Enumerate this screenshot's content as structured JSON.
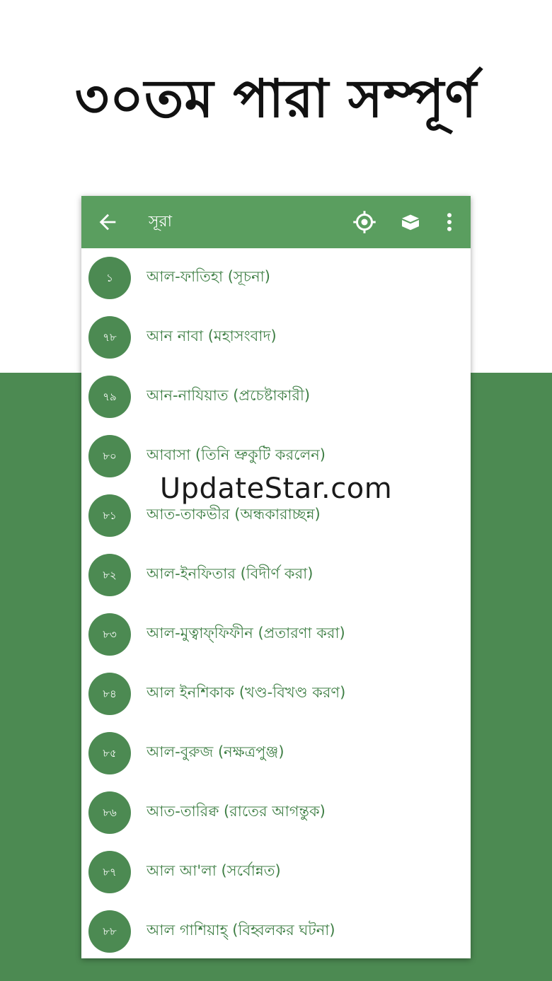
{
  "headline": "৩০তম পারা সম্পূর্ণ",
  "toolbar": {
    "title": "সূরা",
    "back_icon": "arrow-left-icon",
    "actions": [
      "target-icon",
      "kaaba-icon",
      "more-vert-icon"
    ]
  },
  "surahs": [
    {
      "number": "১",
      "name": "আল-ফাতিহা (সূচনা)"
    },
    {
      "number": "৭৮",
      "name": "আন নাবা (মহাসংবাদ)"
    },
    {
      "number": "৭৯",
      "name": "আন-নাযিয়াত (প্রচেষ্টাকারী)"
    },
    {
      "number": "৮০",
      "name": "আবাসা (তিনি ভ্রুকুটি করলেন)"
    },
    {
      "number": "৮১",
      "name": "আত-তাকভীর (অন্ধকারাচ্ছন্ন)"
    },
    {
      "number": "৮২",
      "name": "আল-ইনফিতার (বিদীর্ণ করা)"
    },
    {
      "number": "৮৩",
      "name": "আল-মুত্বাফ্‌ফিফীন (প্রতারণা করা)"
    },
    {
      "number": "৮৪",
      "name": "আল ইনশিকাক (খণ্ড-বিখণ্ড করণ)"
    },
    {
      "number": "৮৫",
      "name": "আল-বুরুজ (নক্ষত্রপুঞ্জ)"
    },
    {
      "number": "৮৬",
      "name": "আত-তারিক্ব (রাতের আগন্তুক)"
    },
    {
      "number": "৮৭",
      "name": "আল আ'লা (সর্বোন্নত)"
    },
    {
      "number": "৮৮",
      "name": "আল গাশিয়াহ্ (বিহ্বলকর ঘটনা)"
    }
  ],
  "watermark": "UpdateStar.com",
  "colors": {
    "appbar": "#5a9e5f",
    "background_green": "#4c8a52",
    "badge": "#4c8a52",
    "list_text": "#3f7f45"
  }
}
